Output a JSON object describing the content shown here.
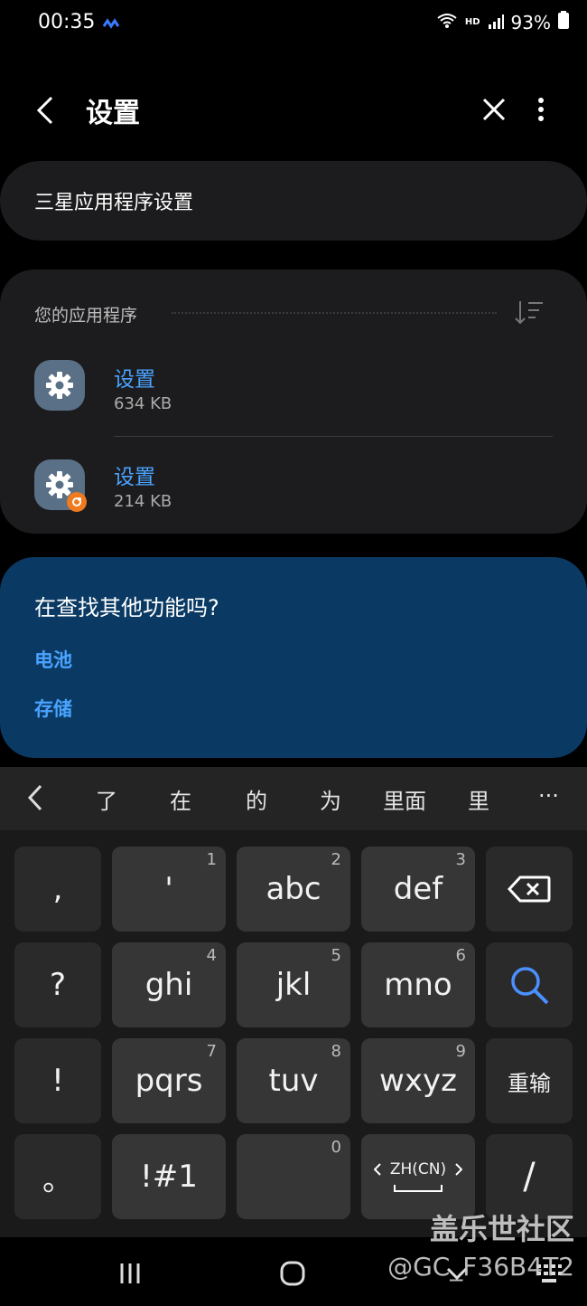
{
  "status": {
    "time": "00:35",
    "hd": "HD",
    "battery": "93%"
  },
  "header": {
    "title": "设置"
  },
  "search": {
    "value": "三星应用程序设置"
  },
  "apps_section": {
    "label": "您的应用程序",
    "items": [
      {
        "name": "设置",
        "size": "634 KB"
      },
      {
        "name": "设置",
        "size": "214 KB"
      }
    ]
  },
  "more_features": {
    "title": "在查找其他功能吗?",
    "links": [
      "电池",
      "存储"
    ]
  },
  "keyboard": {
    "candidates": [
      "了",
      "在",
      "的",
      "为",
      "里面",
      "里"
    ],
    "more": "···",
    "rows": [
      {
        "side": ",",
        "keys": [
          {
            "label": "'",
            "num": "1"
          },
          {
            "label": "abc",
            "num": "2"
          },
          {
            "label": "def",
            "num": "3"
          }
        ]
      },
      {
        "side": "?",
        "keys": [
          {
            "label": "ghi",
            "num": "4"
          },
          {
            "label": "jkl",
            "num": "5"
          },
          {
            "label": "mno",
            "num": "6"
          }
        ]
      },
      {
        "side": "!",
        "keys": [
          {
            "label": "pqrs",
            "num": "7"
          },
          {
            "label": "tuv",
            "num": "8"
          },
          {
            "label": "wxyz",
            "num": "9"
          }
        ],
        "right": "重输"
      },
      {
        "side": "。",
        "keys": [
          {
            "label": "!#1",
            "num": ""
          },
          {
            "label": "",
            "num": "0"
          },
          {
            "label": "ZH(CN)",
            "num": ""
          }
        ],
        "right": "/"
      }
    ]
  },
  "watermark": {
    "line1": "盖乐世社区",
    "line2": "@GC_F36B4T2"
  }
}
